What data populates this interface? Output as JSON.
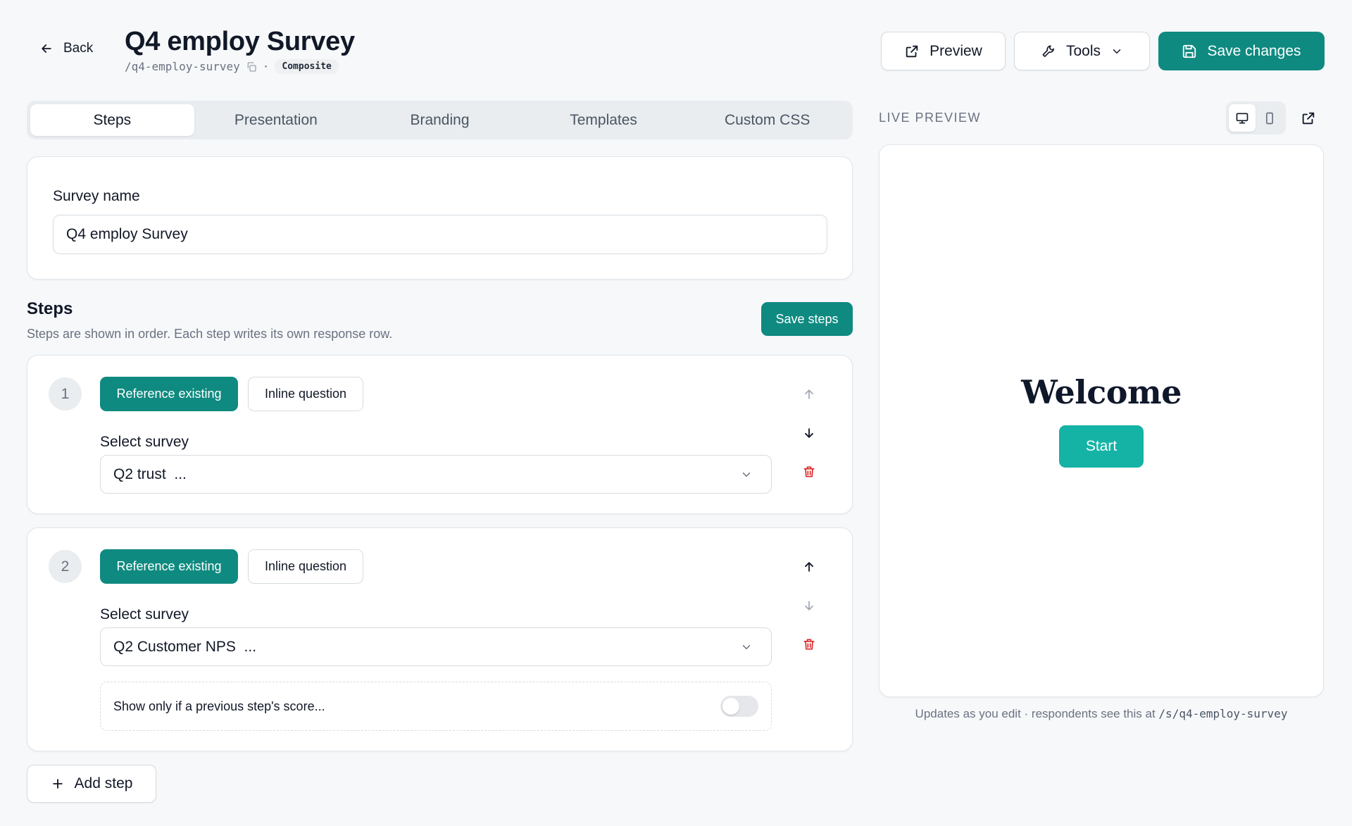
{
  "header": {
    "back_label": "Back",
    "title": "Q4 employ Survey",
    "slug": "/q4-employ-survey",
    "separator": "·",
    "badge": "Composite",
    "preview_label": "Preview",
    "tools_label": "Tools",
    "save_label": "Save changes"
  },
  "tabs": [
    {
      "label": "Steps",
      "active": true
    },
    {
      "label": "Presentation",
      "active": false
    },
    {
      "label": "Branding",
      "active": false
    },
    {
      "label": "Templates",
      "active": false
    },
    {
      "label": "Custom CSS",
      "active": false
    }
  ],
  "survey_name": {
    "label": "Survey name",
    "value": "Q4 employ Survey"
  },
  "steps_section": {
    "title": "Steps",
    "subtitle": "Steps are shown in order. Each step writes its own response row.",
    "save_label": "Save steps",
    "add_label": "Add step"
  },
  "steps": [
    {
      "number": "1",
      "mode_reference": "Reference existing",
      "mode_inline": "Inline question",
      "select_label": "Select survey",
      "selected": "Q2 trust  ..."
    },
    {
      "number": "2",
      "mode_reference": "Reference existing",
      "mode_inline": "Inline question",
      "select_label": "Select survey",
      "selected": "Q2 Customer NPS  ...",
      "condition_label": "Show only if a previous step's score..."
    }
  ],
  "live_preview": {
    "label": "LIVE PREVIEW",
    "welcome": "Welcome",
    "start_label": "Start",
    "footnote_text": "Updates as you edit · respondents see this at ",
    "footnote_path": "/s/q4-employ-survey"
  },
  "colors": {
    "primary": "#0f8a80",
    "start_button": "#14b3a5",
    "danger": "#dc2626"
  }
}
